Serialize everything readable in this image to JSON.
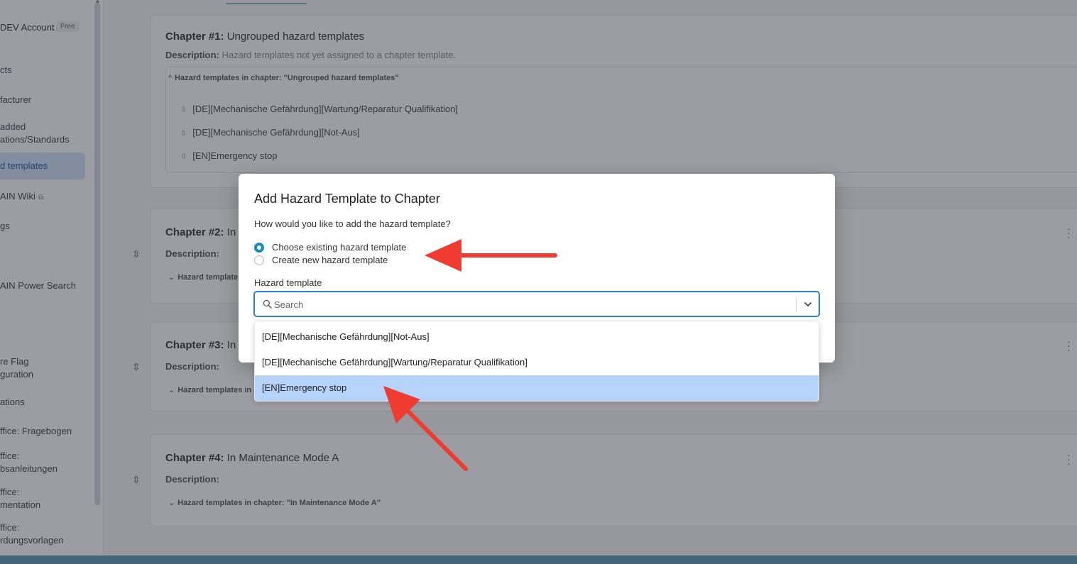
{
  "sidebar": {
    "account_name": "DEV Account",
    "plan_badge": "Free",
    "items": [
      {
        "label": "cts"
      },
      {
        "label": "facturer"
      },
      {
        "label": "added"
      },
      {
        "label": "ations/Standards"
      },
      {
        "label": "d templates"
      },
      {
        "label": "AIN Wiki"
      },
      {
        "label": "gs"
      },
      {
        "label": "AIN Power Search"
      },
      {
        "label": "re Flag"
      },
      {
        "label": "guration"
      },
      {
        "label": "ations"
      },
      {
        "label": "ffice: Fragebogen"
      },
      {
        "label": "ffice:"
      },
      {
        "label": "bsanleitungen"
      },
      {
        "label": "ffice:"
      },
      {
        "label": "mentation"
      },
      {
        "label": "ffice:"
      },
      {
        "label": "rdungsvorlagen"
      }
    ]
  },
  "chapters": [
    {
      "title_prefix": "Chapter #1:",
      "title_name": "Ungrouped hazard templates",
      "desc_label": "Description:",
      "desc_text": "Hazard templates not yet assigned to a chapter template.",
      "accordion": "Hazard templates in chapter: \"Ungrouped hazard templates\"",
      "hazards": [
        "[DE][Mechanische Gefährdung][Wartung/Reparatur Qualifikation]",
        "[DE][Mechanische Gefährdung][Not-Aus]",
        "[EN]Emergency stop"
      ]
    },
    {
      "title_prefix": "Chapter #2:",
      "title_name": "In",
      "desc_label": "Description:",
      "accordion": "Hazard templates"
    },
    {
      "title_prefix": "Chapter #3:",
      "title_name": "In",
      "desc_label": "Description:",
      "accordion": "Hazard templates in chap"
    },
    {
      "title_prefix": "Chapter #4:",
      "title_name": "In Maintenance Mode A",
      "desc_label": "Description:",
      "accordion": "Hazard templates in chapter: \"In Maintenance Mode A\""
    }
  ],
  "modal": {
    "title": "Add Hazard Template to Chapter",
    "question": "How would you like to add the hazard template?",
    "options": [
      {
        "label": "Choose existing hazard template",
        "checked": true
      },
      {
        "label": "Create new hazard template",
        "checked": false
      }
    ],
    "field_label": "Hazard template",
    "search_placeholder": "Search",
    "dropdown_options": [
      "[DE][Mechanische Gefährdung][Not-Aus]",
      "[DE][Mechanische Gefährdung][Wartung/Reparatur Qualifikation]",
      "[EN]Emergency stop"
    ],
    "highlighted_index": 2
  },
  "icons": {
    "search": "search-icon",
    "chevron": "chevron-down-icon",
    "external": "external-link-icon",
    "drag": "drag-handle-icon",
    "kebab": "kebab-menu-icon",
    "reorder": "reorder-icon"
  },
  "colors": {
    "accent": "#1a8ab8",
    "focus_border": "#2f7fd9",
    "highlight": "#b6d4fb",
    "annotation_arrow": "#f03b32",
    "active_nav": "#cfe2fb",
    "bottom_bar": "#5d98b5"
  }
}
